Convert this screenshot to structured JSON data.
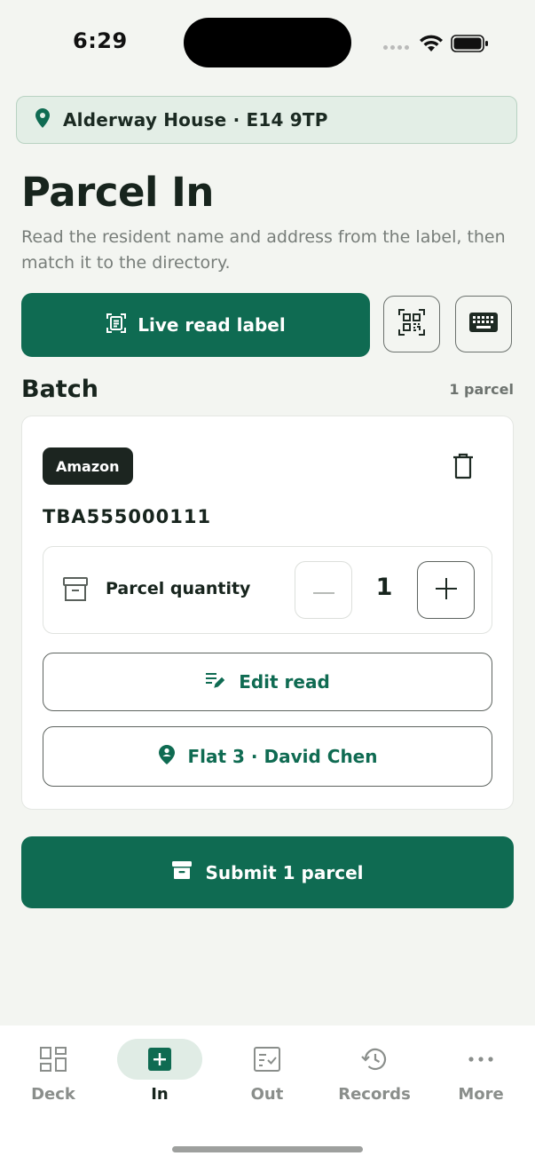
{
  "status_bar": {
    "time": "6:29"
  },
  "location": {
    "text": "Alderway House · E14 9TP",
    "icon": "map-pin-icon"
  },
  "page": {
    "title": "Parcel In",
    "subtitle": "Read the resident name and address from the label, then match it to the directory."
  },
  "actions": {
    "live_read_label": "Live read label",
    "qr_icon": "qr-code-icon",
    "keyboard_icon": "keyboard-icon"
  },
  "batch": {
    "title": "Batch",
    "count": "1 parcel",
    "item": {
      "carrier": "Amazon",
      "tracking": "TBA555000111",
      "quantity_label": "Parcel quantity",
      "quantity": "1",
      "edit_label": "Edit read",
      "recipient_label": "Flat 3 · David Chen"
    }
  },
  "submit": {
    "label": "Submit 1 parcel"
  },
  "tabs": [
    {
      "label": "Deck",
      "icon": "dashboard-icon",
      "active": false
    },
    {
      "label": "In",
      "icon": "plus-box-icon",
      "active": true
    },
    {
      "label": "Out",
      "icon": "checklist-icon",
      "active": false
    },
    {
      "label": "Records",
      "icon": "history-icon",
      "active": false
    },
    {
      "label": "More",
      "icon": "more-dots-icon",
      "active": false
    }
  ],
  "colors": {
    "brand_green": "#0f6b52",
    "background": "#f3f5f1",
    "location_bg": "#e3eee6",
    "badge_dark": "#1c2520"
  }
}
